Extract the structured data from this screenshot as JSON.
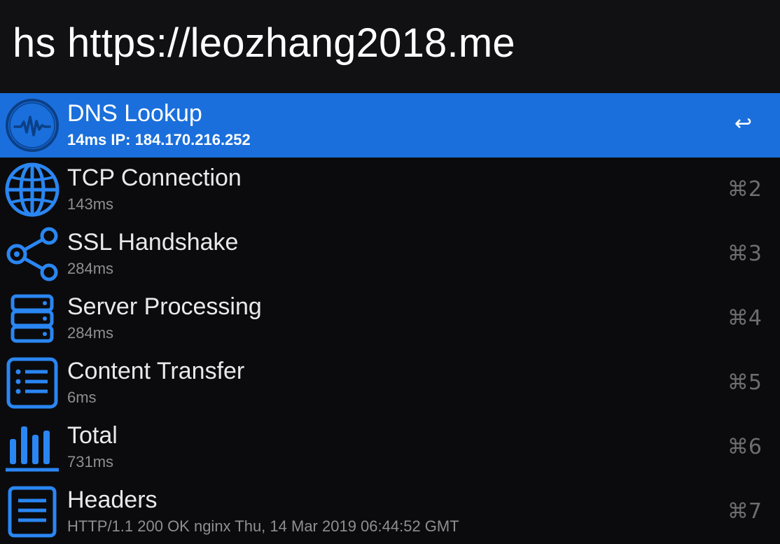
{
  "search": {
    "query": "hs https://leozhang2018.me"
  },
  "accent_color": "#1a6fdc",
  "results": [
    {
      "title": "DNS Lookup",
      "subtitle": "14ms IP: 184.170.216.252",
      "shortcut": "↩",
      "icon": "waveform-icon",
      "selected": true
    },
    {
      "title": "TCP Connection",
      "subtitle": "143ms",
      "shortcut": "⌘2",
      "icon": "globe-icon"
    },
    {
      "title": "SSL Handshake",
      "subtitle": "284ms",
      "shortcut": "⌘3",
      "icon": "share-icon"
    },
    {
      "title": "Server Processing",
      "subtitle": "284ms",
      "shortcut": "⌘4",
      "icon": "server-icon"
    },
    {
      "title": "Content Transfer",
      "subtitle": "6ms",
      "shortcut": "⌘5",
      "icon": "list-icon"
    },
    {
      "title": "Total",
      "subtitle": "731ms",
      "shortcut": "⌘6",
      "icon": "bar-chart-icon"
    },
    {
      "title": "Headers",
      "subtitle": "HTTP/1.1 200 OK nginx Thu, 14 Mar 2019 06:44:52 GMT",
      "shortcut": "⌘7",
      "icon": "document-icon"
    }
  ]
}
